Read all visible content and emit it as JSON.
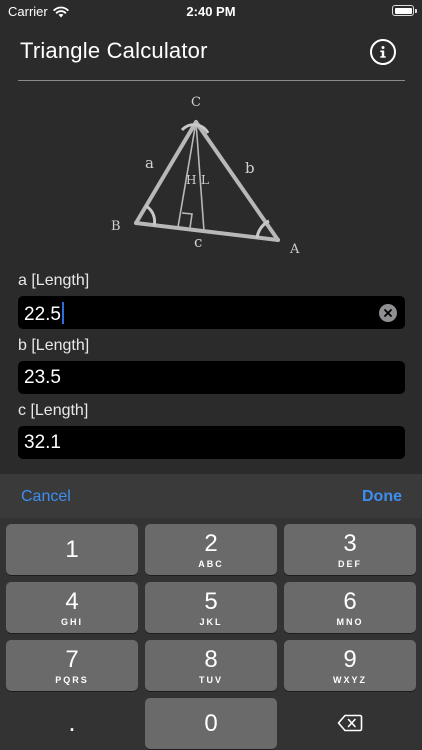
{
  "status": {
    "carrier": "Carrier",
    "time": "2:40 PM"
  },
  "nav": {
    "title": "Triangle Calculator",
    "info_icon": "info-icon"
  },
  "diagram": {
    "vertices": {
      "a": "A",
      "b": "B",
      "c": "C"
    },
    "sides": {
      "a": "a",
      "b": "b",
      "c": "c"
    },
    "inner": {
      "h": "H",
      "l": "L"
    }
  },
  "fields": [
    {
      "label": "a [Length]",
      "value": "22.5"
    },
    {
      "label": "b [Length]",
      "value": "23.5"
    },
    {
      "label": "c [Length]",
      "value": "32.1"
    }
  ],
  "toolbar": {
    "cancel": "Cancel",
    "done": "Done"
  },
  "keypad": {
    "keys": [
      {
        "num": "1",
        "letters": ""
      },
      {
        "num": "2",
        "letters": "ABC"
      },
      {
        "num": "3",
        "letters": "DEF"
      },
      {
        "num": "4",
        "letters": "GHI"
      },
      {
        "num": "5",
        "letters": "JKL"
      },
      {
        "num": "6",
        "letters": "MNO"
      },
      {
        "num": "7",
        "letters": "PQRS"
      },
      {
        "num": "8",
        "letters": "TUV"
      },
      {
        "num": "9",
        "letters": "WXYZ"
      },
      {
        "num": "."
      },
      {
        "num": "0"
      }
    ],
    "backspace_icon": "backspace-icon"
  },
  "colors": {
    "accent": "#3d8ef0",
    "caret": "#2d6cdf",
    "background": "#2b2b2b"
  }
}
